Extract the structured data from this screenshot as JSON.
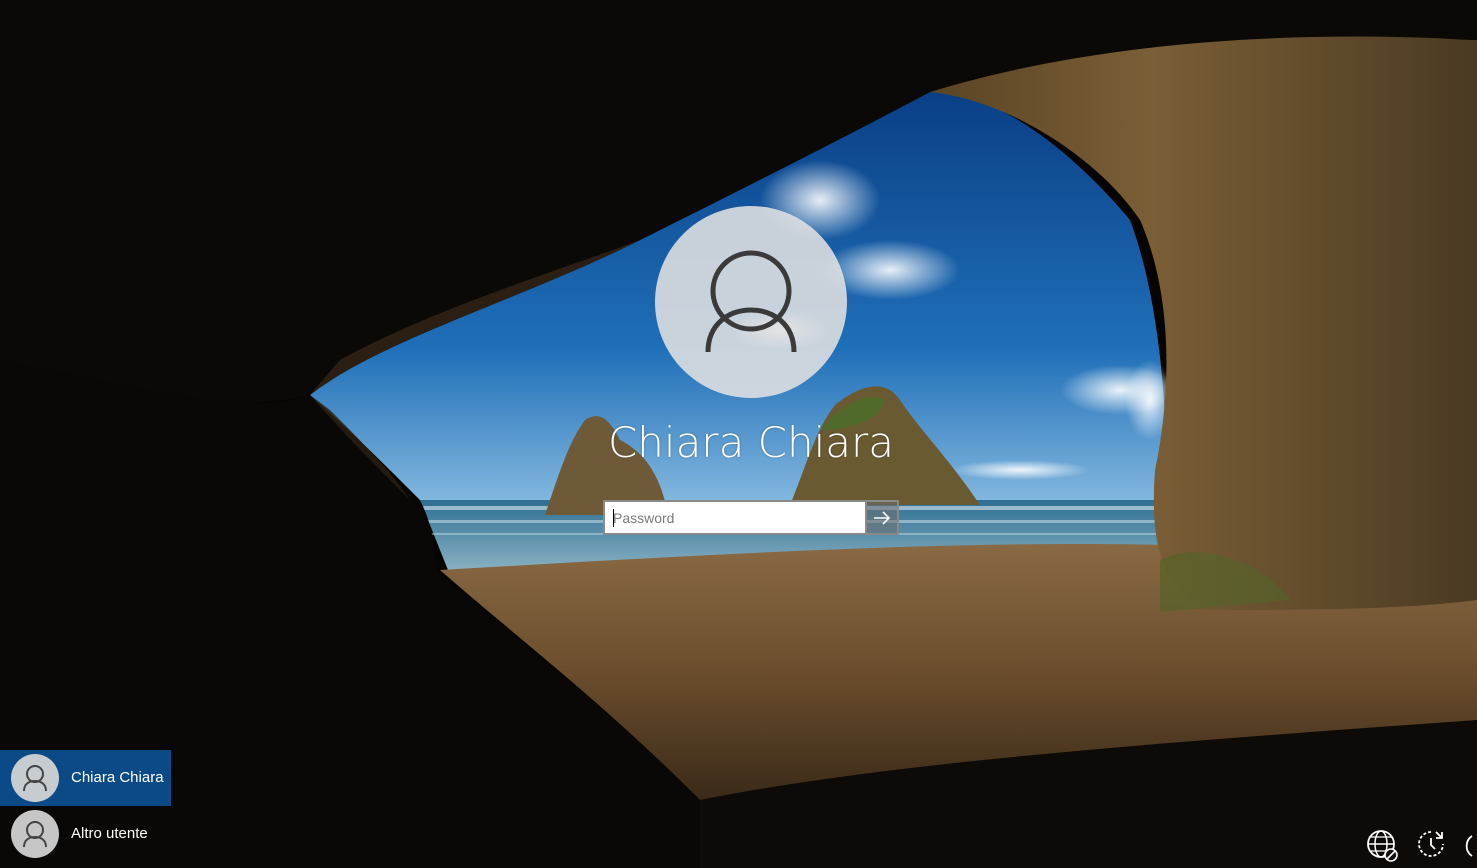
{
  "login": {
    "username": "Chiara Chiara",
    "password_placeholder": "Password",
    "submit_icon": "arrow-right-icon"
  },
  "user_list": [
    {
      "label": "Chiara Chiara",
      "icon": "user-avatar-icon",
      "selected": true
    },
    {
      "label": "Altro utente",
      "icon": "user-avatar-icon",
      "selected": false
    }
  ],
  "tray": [
    {
      "icon": "network-disconnected-icon"
    },
    {
      "icon": "ease-of-access-icon"
    },
    {
      "icon": "power-icon"
    }
  ],
  "colors": {
    "selected_user_bg": "#0b4a86",
    "avatar_bg": "#e1e1e1"
  }
}
